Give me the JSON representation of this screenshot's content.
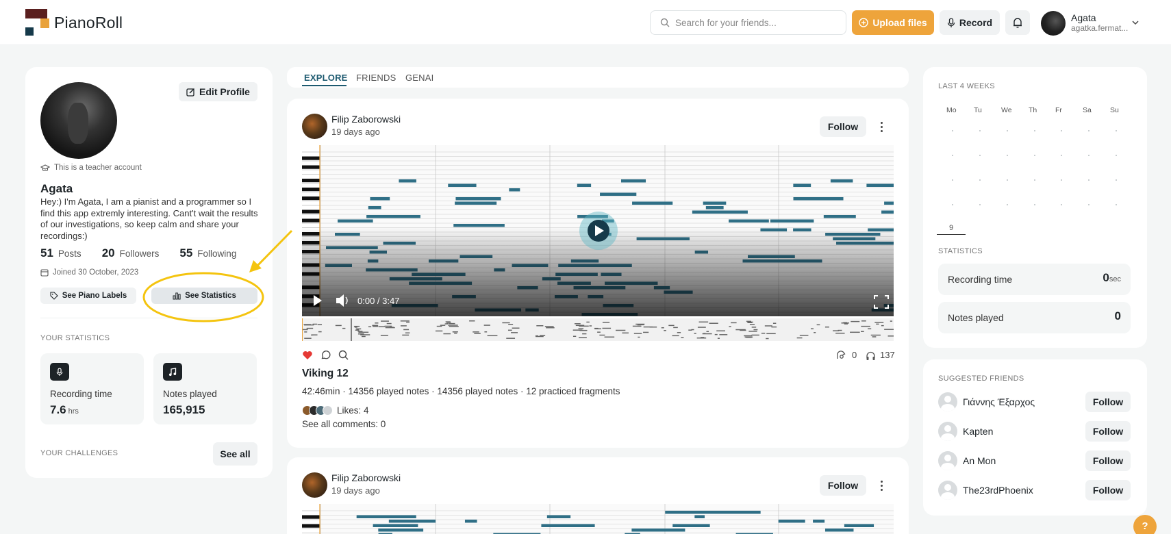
{
  "app": {
    "name": "PianoRoll"
  },
  "header": {
    "search_placeholder": "Search for your friends...",
    "upload_label": "Upload files",
    "record_label": "Record",
    "user_name": "Agata",
    "user_email": "agatka.fermat..."
  },
  "profile": {
    "edit_label": "Edit Profile",
    "teacher_note": "This is a teacher account",
    "name": "Agata",
    "bio": "Hey:) I'm Agata, I am a pianist and a programmer so I find this app extremly interesting. Cant't wait the results of our investigations, so keep calm and share your recordings:)",
    "posts_count": "51",
    "posts_label": "Posts",
    "followers_count": "20",
    "followers_label": "Followers",
    "following_count": "55",
    "following_label": "Following",
    "joined": "Joined 30 October, 2023",
    "piano_labels_btn": "See Piano Labels",
    "statistics_btn": "See Statistics",
    "your_statistics_title": "YOUR STATISTICS",
    "recording_time_label": "Recording time",
    "recording_time_value": "7.6",
    "recording_time_unit": "hrs",
    "notes_played_label": "Notes played",
    "notes_played_value": "165,915",
    "challenges_title": "YOUR CHALLENGES",
    "see_all_label": "See all"
  },
  "feed": {
    "tabs": [
      "EXPLORE",
      "FRIENDS",
      "GENAI"
    ],
    "active_tab": "EXPLORE",
    "posts": [
      {
        "author": "Filip Zaborowski",
        "time": "19 days ago",
        "follow_label": "Follow",
        "video_time": "0:00 / 3:47",
        "reposts": "0",
        "listens": "137",
        "title": "Viking 12",
        "meta": "42:46min · 14356 played notes · 14356 played notes · 12 practiced fragments",
        "likes": "Likes: 4",
        "comments": "See all comments: 0",
        "progress": 0
      },
      {
        "author": "Filip Zaborowski",
        "time": "19 days ago",
        "follow_label": "Follow"
      }
    ]
  },
  "sidebar": {
    "last_weeks_title": "LAST 4 WEEKS",
    "weekdays": [
      "Mo",
      "Tu",
      "We",
      "Th",
      "Fr",
      "Sa",
      "Su"
    ],
    "current_day": "9",
    "statistics_title": "STATISTICS",
    "recording_time_label": "Recording time",
    "recording_time_value": "0",
    "recording_time_unit": "sec",
    "notes_played_label": "Notes played",
    "notes_played_value": "0",
    "suggested_title": "SUGGESTED FRIENDS",
    "friends": [
      {
        "name": "Γιάννης Έξαρχος",
        "follow": "Follow"
      },
      {
        "name": "Kapten",
        "follow": "Follow"
      },
      {
        "name": "An Mon",
        "follow": "Follow"
      },
      {
        "name": "The23rdPhoenix",
        "follow": "Follow"
      }
    ]
  },
  "help_label": "?",
  "colors": {
    "accent": "#eea43b",
    "brand_dark": "#1d5a70",
    "note": "#2f6f86",
    "annotation": "#f4c40f"
  },
  "icons": [
    "search-icon",
    "upload-icon",
    "mic-icon",
    "bell-icon",
    "chevron-down-icon",
    "edit-icon",
    "graduation-cap-icon",
    "calendar-icon",
    "tag-icon",
    "bar-chart-icon",
    "music-note-icon",
    "heart-icon",
    "comment-icon",
    "magnifier-icon",
    "repost-icon",
    "headphones-icon",
    "play-icon",
    "volume-icon",
    "fullscreen-icon",
    "kebab-icon"
  ]
}
